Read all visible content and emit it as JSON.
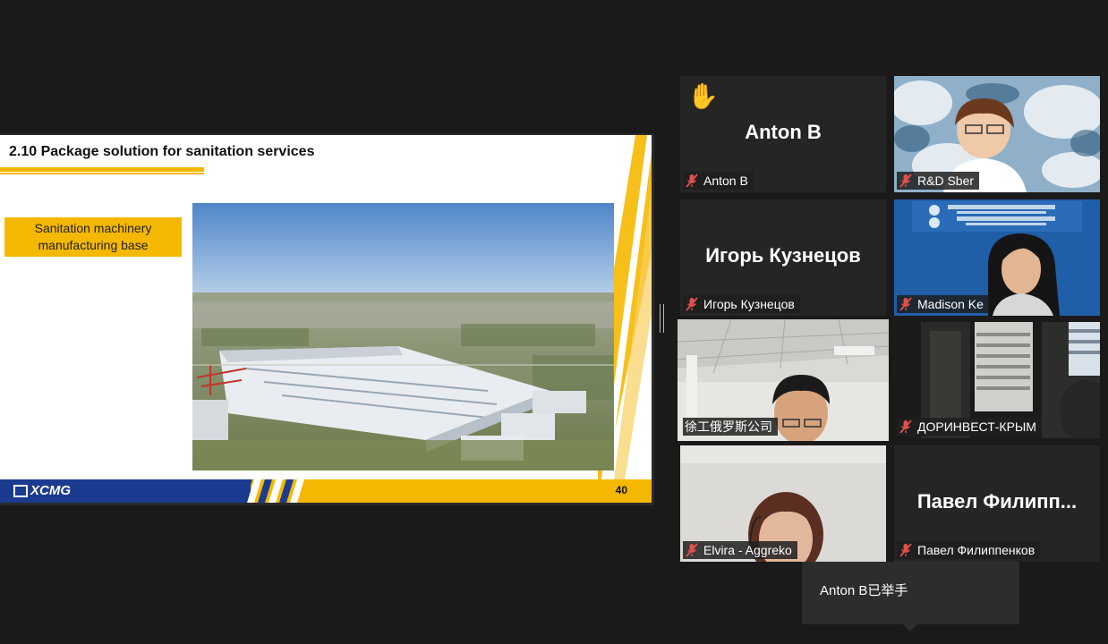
{
  "slide": {
    "title": "2.10 Package solution for sanitation services",
    "label": "Sanitation machinery manufacturing base",
    "brand": "XCMG",
    "page_number": "40",
    "accent_color": "#f5b800",
    "brand_color": "#1a3b8f"
  },
  "participants": [
    {
      "display": "Anton B",
      "label": "Anton B",
      "mic": "muted",
      "hand_raised": true,
      "video": false
    },
    {
      "display": "",
      "label": "R&D Sber",
      "mic": "muted",
      "video": true
    },
    {
      "display": "Игорь Кузнецов",
      "label": "Игорь Кузнецов",
      "mic": "muted",
      "video": false
    },
    {
      "display": "",
      "label": "Madison Ke",
      "mic": "muted",
      "video": true
    },
    {
      "display": "",
      "label": "徐工俄罗斯公司",
      "mic": "on",
      "video": true,
      "active_speaker": true
    },
    {
      "display": "",
      "label": "ДОРИНВЕСТ-КРЫМ",
      "mic": "muted",
      "video": true
    },
    {
      "display": "",
      "label": "Elvira - Aggreko",
      "mic": "muted",
      "video": true
    },
    {
      "display": "Павел  Филипп...",
      "label": "Павел Филиппенков",
      "mic": "muted",
      "video": false
    }
  ],
  "notification": {
    "text": "Anton B已举手"
  }
}
